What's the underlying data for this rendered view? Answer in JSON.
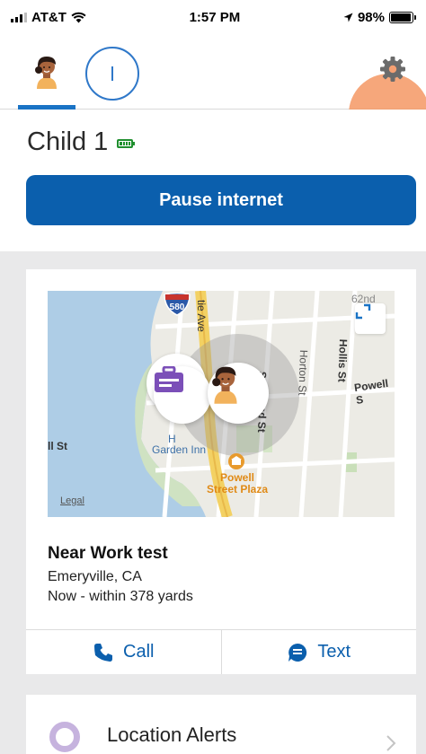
{
  "status_bar": {
    "carrier": "AT&T",
    "time": "1:57 PM",
    "battery": "98%"
  },
  "top_bar": {
    "profiles": [
      {
        "icon": "child-avatar-icon",
        "selected": true
      }
    ],
    "add_profile_icon": "add-profile-icon",
    "settings_icon": "gear-icon"
  },
  "child": {
    "name": "Child 1",
    "battery_icon": "battery-full-icon",
    "pause_label": "Pause internet"
  },
  "location": {
    "map": {
      "labels": {
        "highway": "580",
        "street_1": "tie Ave",
        "street_2": "62nd",
        "street_3": "Horton St",
        "street_4": "Hollis St",
        "street_5": "Powell S",
        "street_6": "ll St",
        "street_7": "St",
        "street_8": "nd St",
        "hotel": "Garden Inn",
        "hotel_prefix": "H",
        "poi": "Powell Street Plaza",
        "legal": "Legal"
      },
      "place_icon": "work-briefcase-icon"
    },
    "title": "Near Work test",
    "city": "Emeryville, CA",
    "when": "Now - within 378 yards",
    "call_label": "Call",
    "text_label": "Text"
  },
  "alerts": {
    "label": "Location Alerts"
  },
  "colors": {
    "primary": "#0b5fad",
    "gear_highlight": "#f4915a",
    "battery_green": "#1f8f2e",
    "alerts_purple": "#c6b3de"
  }
}
